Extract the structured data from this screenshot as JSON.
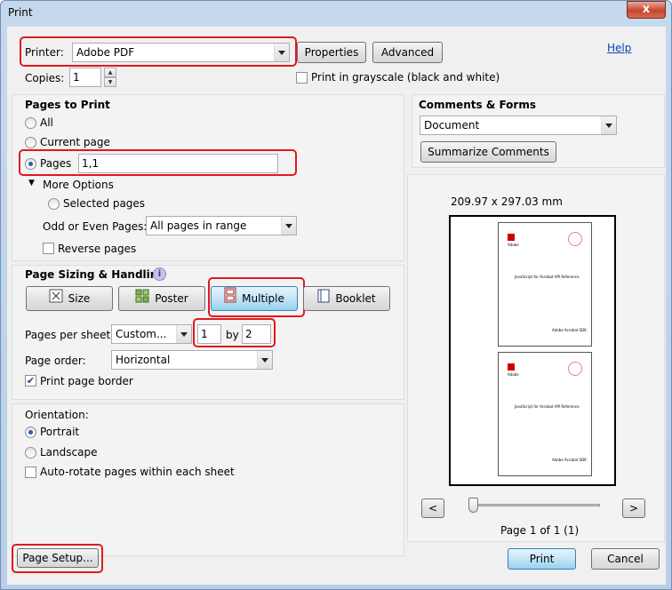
{
  "window": {
    "title": "Print",
    "close_glyph": "x"
  },
  "printer": {
    "label": "Printer:",
    "value": "Adobe PDF",
    "properties_label": "Properties",
    "advanced_label": "Advanced",
    "help_label": "Help"
  },
  "copies": {
    "label": "Copies:",
    "value": "1",
    "grayscale_label": "Print in grayscale (black and white)",
    "grayscale_checked": false
  },
  "pages_to_print": {
    "title": "Pages to Print",
    "all_label": "All",
    "current_label": "Current page",
    "pages_label": "Pages",
    "pages_value": "1,1",
    "selected": "pages",
    "more_options_label": "More Options",
    "selected_pages_label": "Selected pages",
    "odd_even_label": "Odd or Even Pages:",
    "odd_even_value": "All pages in range",
    "reverse_label": "Reverse pages"
  },
  "comments_forms": {
    "title": "Comments & Forms",
    "value": "Document",
    "summarize_label": "Summarize Comments"
  },
  "sizing": {
    "title": "Page Sizing & Handling",
    "info_glyph": "i",
    "size_label": "Size",
    "poster_label": "Poster",
    "multiple_label": "Multiple",
    "booklet_label": "Booklet",
    "active": "multiple",
    "pages_per_sheet_label": "Pages per sheet:",
    "pages_per_sheet_value": "Custom...",
    "cols_value": "1",
    "by_label": "by",
    "rows_value": "2",
    "page_order_label": "Page order:",
    "page_order_value": "Horizontal",
    "border_label": "Print page border",
    "border_checked": true
  },
  "orientation": {
    "title": "Orientation:",
    "portrait_label": "Portrait",
    "landscape_label": "Landscape",
    "autorotate_label": "Auto-rotate pages within each sheet",
    "selected": "portrait"
  },
  "preview": {
    "dimensions": "209.97 x 297.03 mm",
    "prev_glyph": "<",
    "next_glyph": ">",
    "page_label": "Page 1 of 1 (1)",
    "thumb_title": "JavaScript for Acrobat API Reference",
    "thumb_brand": "Adobe",
    "thumb_footer": "Adobe Acrobat SDK"
  },
  "footer": {
    "page_setup_label": "Page Setup...",
    "print_label": "Print",
    "cancel_label": "Cancel"
  },
  "colors": {
    "highlight": "#e0191e",
    "window_frame": "#b9cfe7",
    "close": "#c7452b"
  },
  "icons": [
    "close-icon",
    "size-icon",
    "poster-icon",
    "multiple-icon",
    "booklet-icon",
    "info-icon",
    "triangle-down-icon"
  ]
}
